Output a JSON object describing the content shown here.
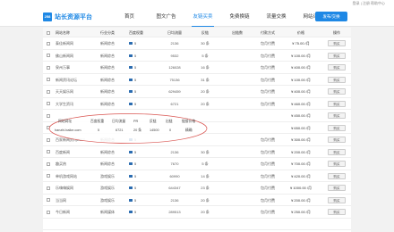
{
  "topbar": {
    "links": "登录 | 注册      帮助中心"
  },
  "header": {
    "logo_badge": "258",
    "logo_text": "站长资源平台",
    "nav": [
      "首页",
      "图文广告",
      "友链买卖",
      "免费换链",
      "流量交换",
      "网站评估"
    ],
    "active_nav": 2,
    "publish_button": "发布/交换"
  },
  "table": {
    "headers": [
      "",
      "网站名称",
      "行业分类",
      "百度权重",
      "",
      "PR",
      "日均流量",
      "反链",
      "出链数",
      "付款方式",
      "价格",
      "操作"
    ],
    "rows": [
      {
        "name": "泰佳新闻网",
        "industry": "新闻综合",
        "weight": "5",
        "pv": "2136",
        "links": "30 条",
        "pay": "包月付费",
        "price": "¥ 75.00 /月",
        "op": "购买"
      },
      {
        "name": "佛山新闻网",
        "industry": "新闻综合",
        "weight": "5",
        "pv": "9532",
        "links": "5 条",
        "pay": "包月付费",
        "price": "¥ 100.00 /月",
        "op": "购买"
      },
      {
        "name": "泉州万事",
        "industry": "新闻综合",
        "weight": "5",
        "pv": "126028",
        "links": "16 条",
        "pay": "包月付费",
        "price": "¥ 400.00 /月",
        "op": "购买"
      },
      {
        "name": "新闻资讯论坛",
        "industry": "新闻综合",
        "weight": "5",
        "pv": "75136",
        "links": "31 条",
        "pay": "包月付费",
        "price": "¥ 100.00 /月",
        "op": "购买"
      },
      {
        "name": "天天娱乐网",
        "industry": "新闻综合",
        "weight": "5",
        "pv": "629459",
        "links": "20 条",
        "pay": "包月付费",
        "price": "¥ 400.00 /月",
        "op": "购买"
      },
      {
        "name": "大学生资讯",
        "industry": "新闻综合",
        "weight": "5",
        "pv": "6721",
        "links": "20 条",
        "pay": "包月付费",
        "price": "¥ 460.00 /月",
        "op": "购买"
      },
      {
        "name": "",
        "industry": "",
        "weight": "",
        "pv": "",
        "links": "",
        "pay": "",
        "price": "¥ 450.00 /月",
        "op": "购买"
      },
      {
        "name": "",
        "industry": "",
        "weight": "",
        "pv": "",
        "links": "",
        "pay": "",
        "price": "¥ 650.00 /月",
        "op": "购买"
      },
      {
        "name": "百家新闻资讯2017",
        "industry": "新闻综合",
        "weight": "5",
        "pv": "",
        "links": "",
        "pay": "包月付费",
        "price": "¥ 300.00 /月",
        "op": "购买"
      },
      {
        "name": "百度新闻",
        "industry": "新闻综合",
        "weight": "5",
        "pv": "2136",
        "links": "30 条",
        "pay": "包月付费",
        "price": "¥ 200.00 /月",
        "op": "购买"
      },
      {
        "name": "趣买热",
        "industry": "新闻综合",
        "weight": "5",
        "pv": "7670",
        "links": "5 条",
        "pay": "包月付费",
        "price": "¥ 700.00 /月",
        "op": "购买"
      },
      {
        "name": "单机游戏网站",
        "industry": "游戏娱乐",
        "weight": "5",
        "pv": "60990",
        "links": "14 条",
        "pay": "包月付费",
        "price": "¥ 420.00 /月",
        "op": "购买"
      },
      {
        "name": "乐嗨嗨娱网",
        "industry": "游戏娱乐",
        "weight": "5",
        "pv": "644347",
        "links": "23 条",
        "pay": "包月付费",
        "price": "¥ 1000.00 /月",
        "op": "购买"
      },
      {
        "name": "当当网",
        "industry": "游戏娱乐",
        "weight": "5",
        "pv": "2136",
        "links": "20 条",
        "pay": "包月付费",
        "price": "¥ 200.00 /月",
        "op": "购买"
      },
      {
        "name": "今日新闻",
        "industry": "新闻媒体",
        "weight": "5",
        "pv": "289513",
        "links": "20 条",
        "pay": "包月付费",
        "price": "¥ 250.00 /月",
        "op": "购买"
      },
      {
        "name": "",
        "industry": "",
        "weight": "",
        "pv": "",
        "links": "",
        "pay": "",
        "price": "",
        "op": ""
      }
    ]
  },
  "popup": {
    "headers": [
      "网站网址",
      "百度权重",
      "日均流量",
      "PR",
      "反链",
      "出链",
      "链接价格"
    ],
    "values": [
      "hanzhi.baike.com",
      "5",
      "6721",
      "20 条",
      "14500",
      "0",
      "精确"
    ]
  }
}
